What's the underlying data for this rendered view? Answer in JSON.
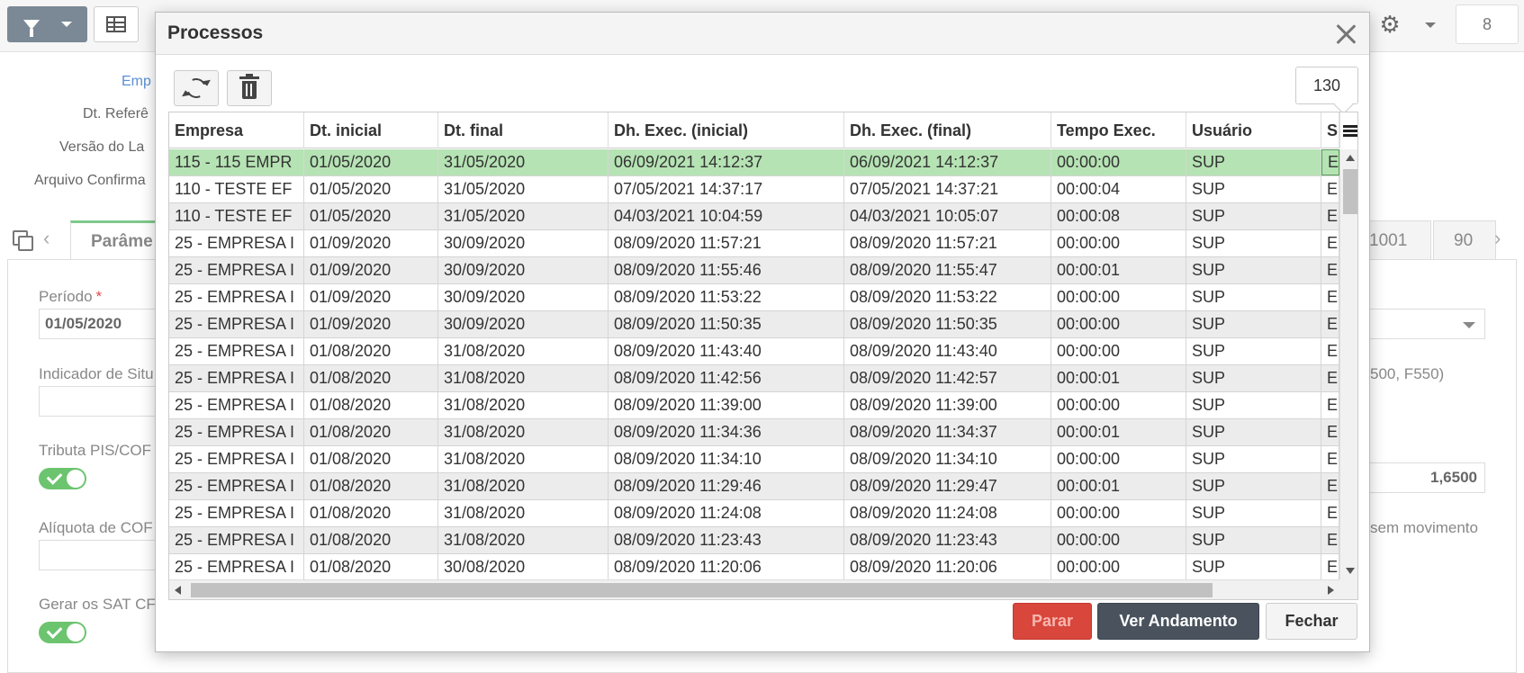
{
  "background": {
    "toolbar": {
      "count_bubble": "8"
    },
    "form_labels": [
      {
        "text": "Emp"
      },
      {
        "text": "Dt. Referê"
      },
      {
        "text": "Versão do La"
      },
      {
        "text": "Arquivo Confirma"
      }
    ],
    "tabs": [
      {
        "label": "Parâme"
      },
      {
        "label": "1001"
      },
      {
        "label": "90"
      }
    ],
    "fields": {
      "periodo_label": "Período",
      "periodo_required": "*",
      "periodo_value": "01/05/2020",
      "indicador_label": "Indicador de Situ",
      "tributa_label": "Tributa PIS/COF",
      "aliquota_label": "Alíquota de COF",
      "gerar_label": "Gerar os SAT CF",
      "right_hint_1": "500, F550)",
      "right_value": "1,6500",
      "right_hint_2": "sem movimento"
    }
  },
  "modal": {
    "title": "Processos",
    "record_count": "130",
    "columns": [
      "Empresa",
      "Dt. inicial",
      "Dt. final",
      "Dh. Exec. (inicial)",
      "Dh. Exec. (final)",
      "Tempo Exec.",
      "Usuário",
      "S"
    ],
    "rows": [
      [
        "115 - 115 EMPR",
        "01/05/2020",
        "31/05/2020",
        "06/09/2021 14:12:37",
        "06/09/2021 14:12:37",
        "00:00:00",
        "SUP",
        "E"
      ],
      [
        "110 - TESTE EF",
        "01/05/2020",
        "31/05/2020",
        "07/05/2021 14:37:17",
        "07/05/2021 14:37:21",
        "00:00:04",
        "SUP",
        "E"
      ],
      [
        "110 - TESTE EF",
        "01/05/2020",
        "31/05/2020",
        "04/03/2021 10:04:59",
        "04/03/2021 10:05:07",
        "00:00:08",
        "SUP",
        "E"
      ],
      [
        "25 - EMPRESA I",
        "01/09/2020",
        "30/09/2020",
        "08/09/2020 11:57:21",
        "08/09/2020 11:57:21",
        "00:00:00",
        "SUP",
        "E"
      ],
      [
        "25 - EMPRESA I",
        "01/09/2020",
        "30/09/2020",
        "08/09/2020 11:55:46",
        "08/09/2020 11:55:47",
        "00:00:01",
        "SUP",
        "E"
      ],
      [
        "25 - EMPRESA I",
        "01/09/2020",
        "30/09/2020",
        "08/09/2020 11:53:22",
        "08/09/2020 11:53:22",
        "00:00:00",
        "SUP",
        "E"
      ],
      [
        "25 - EMPRESA I",
        "01/09/2020",
        "30/09/2020",
        "08/09/2020 11:50:35",
        "08/09/2020 11:50:35",
        "00:00:00",
        "SUP",
        "E"
      ],
      [
        "25 - EMPRESA I",
        "01/08/2020",
        "31/08/2020",
        "08/09/2020 11:43:40",
        "08/09/2020 11:43:40",
        "00:00:00",
        "SUP",
        "E"
      ],
      [
        "25 - EMPRESA I",
        "01/08/2020",
        "31/08/2020",
        "08/09/2020 11:42:56",
        "08/09/2020 11:42:57",
        "00:00:01",
        "SUP",
        "E"
      ],
      [
        "25 - EMPRESA I",
        "01/08/2020",
        "31/08/2020",
        "08/09/2020 11:39:00",
        "08/09/2020 11:39:00",
        "00:00:00",
        "SUP",
        "E"
      ],
      [
        "25 - EMPRESA I",
        "01/08/2020",
        "31/08/2020",
        "08/09/2020 11:34:36",
        "08/09/2020 11:34:37",
        "00:00:01",
        "SUP",
        "E"
      ],
      [
        "25 - EMPRESA I",
        "01/08/2020",
        "31/08/2020",
        "08/09/2020 11:34:10",
        "08/09/2020 11:34:10",
        "00:00:00",
        "SUP",
        "E"
      ],
      [
        "25 - EMPRESA I",
        "01/08/2020",
        "31/08/2020",
        "08/09/2020 11:29:46",
        "08/09/2020 11:29:47",
        "00:00:01",
        "SUP",
        "E"
      ],
      [
        "25 - EMPRESA I",
        "01/08/2020",
        "31/08/2020",
        "08/09/2020 11:24:08",
        "08/09/2020 11:24:08",
        "00:00:00",
        "SUP",
        "E"
      ],
      [
        "25 - EMPRESA I",
        "01/08/2020",
        "31/08/2020",
        "08/09/2020 11:23:43",
        "08/09/2020 11:23:43",
        "00:00:00",
        "SUP",
        "E"
      ],
      [
        "25 - EMPRESA I",
        "01/08/2020",
        "30/08/2020",
        "08/09/2020 11:20:06",
        "08/09/2020 11:20:06",
        "00:00:00",
        "SUP",
        "E"
      ]
    ],
    "selected_row": 0,
    "buttons": {
      "parar": "Parar",
      "ver_andamento": "Ver Andamento",
      "fechar": "Fechar"
    },
    "colors": {
      "selected_row": "#b6e3b4",
      "parar": "#d9463b",
      "ver_andamento": "#49525d"
    }
  }
}
